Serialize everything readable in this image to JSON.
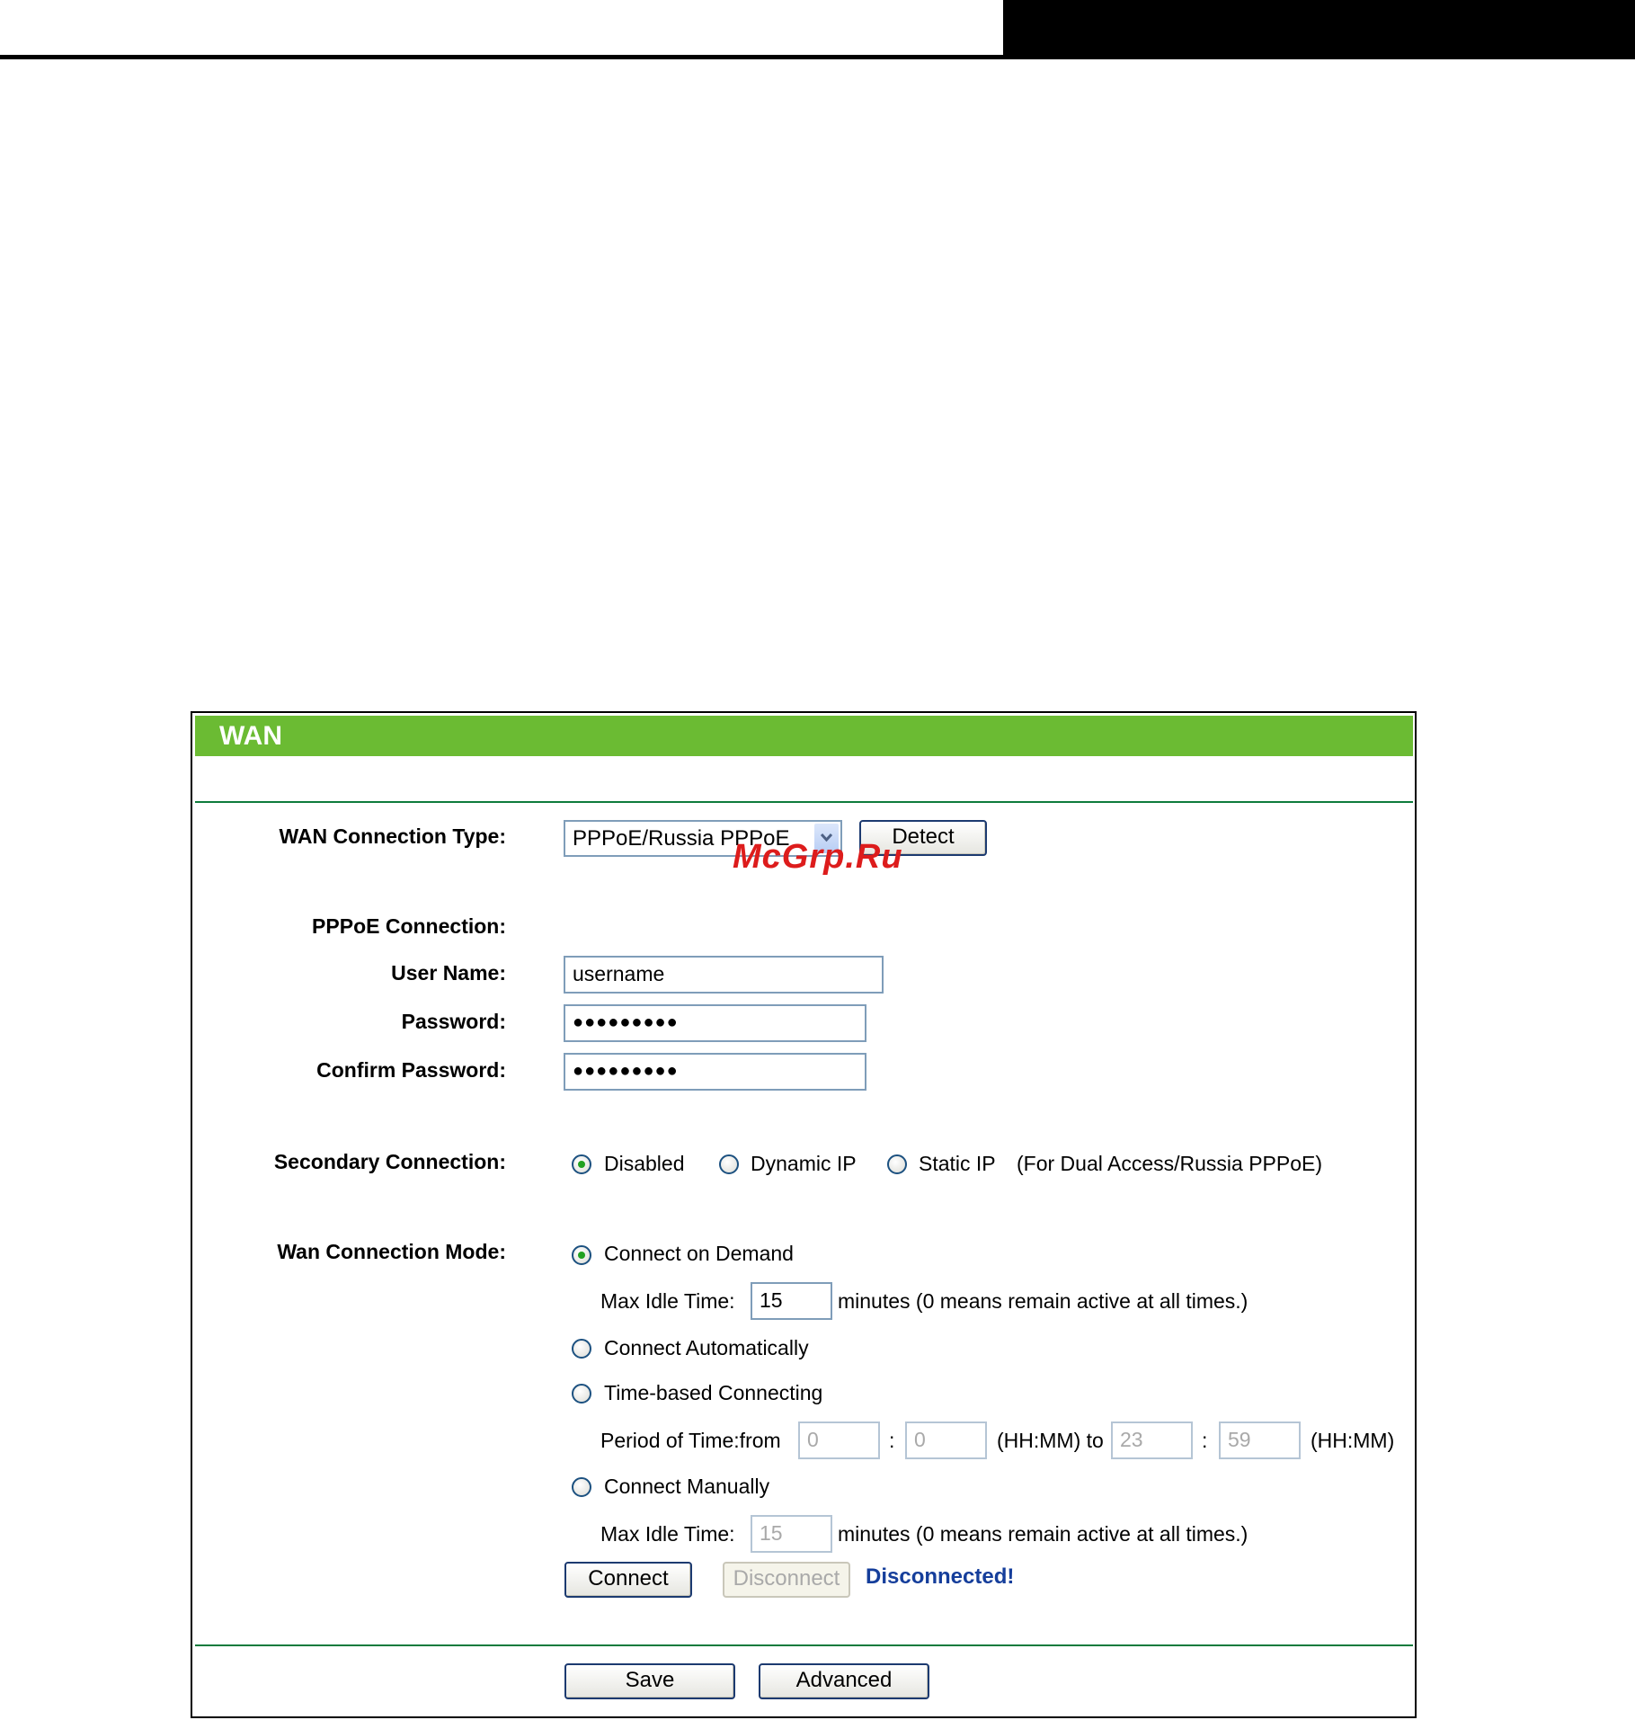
{
  "panel": {
    "title": "WAN"
  },
  "wan_type": {
    "label": "WAN Connection Type:",
    "selected": "PPPoE/Russia PPPoE",
    "detect_label": "Detect"
  },
  "pppoe": {
    "section_label": "PPPoE Connection:",
    "username_label": "User Name:",
    "username_value": "username",
    "password_label": "Password:",
    "password_value": "●●●●●●●●●",
    "confirm_label": "Confirm Password:",
    "confirm_value": "●●●●●●●●●"
  },
  "secondary": {
    "label": "Secondary Connection:",
    "options": [
      "Disabled",
      "Dynamic IP",
      "Static IP"
    ],
    "selected": "Disabled",
    "note": "(For Dual Access/Russia PPPoE)"
  },
  "mode": {
    "label": "Wan Connection Mode:",
    "selected": "Connect on Demand",
    "on_demand": "Connect on Demand",
    "max_idle_label": "Max Idle Time:",
    "max_idle_value": "15",
    "minutes_note": "minutes (0 means remain active at all times.)",
    "automatic": "Connect Automatically",
    "time_based": "Time-based Connecting",
    "period_label": "Period of Time:from",
    "from_hh": "0",
    "from_mm": "0",
    "colon": ":",
    "hhmm_to": "(HH:MM) to",
    "to_hh": "23",
    "to_mm": "59",
    "hhmm": "(HH:MM)",
    "manual": "Connect Manually",
    "manual_idle_label": "Max Idle Time:",
    "manual_idle_value": "15",
    "manual_minutes_note": "minutes (0 means remain active at all times.)"
  },
  "actions": {
    "connect_label": "Connect",
    "disconnect_label": "Disconnect",
    "status": "Disconnected!",
    "save_label": "Save",
    "advanced_label": "Advanced"
  },
  "watermark": "McGrp.Ru",
  "colors": {
    "title_bar": "#6bbb33",
    "divider": "#0e7b3c",
    "status_text": "#153e9b",
    "watermark": "#dd1c1c"
  }
}
